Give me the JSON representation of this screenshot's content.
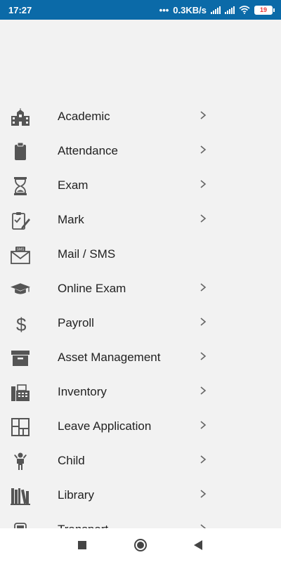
{
  "status_bar": {
    "time": "17:27",
    "network_speed": "0.3KB/s",
    "battery": "19"
  },
  "menu": {
    "items": [
      {
        "label": "Academic",
        "icon": "school-building-icon"
      },
      {
        "label": "Attendance",
        "icon": "clipboard-icon"
      },
      {
        "label": "Exam",
        "icon": "hourglass-icon"
      },
      {
        "label": "Mark",
        "icon": "clipboard-check-pencil-icon"
      },
      {
        "label": "Mail / SMS",
        "icon": "mail-sms-icon"
      },
      {
        "label": "Online Exam",
        "icon": "graduation-cap-icon"
      },
      {
        "label": "Payroll",
        "icon": "dollar-icon"
      },
      {
        "label": "Asset Management",
        "icon": "archive-box-icon"
      },
      {
        "label": "Inventory",
        "icon": "fax-machine-icon"
      },
      {
        "label": "Leave Application",
        "icon": "layout-grid-icon"
      },
      {
        "label": "Child",
        "icon": "child-icon"
      },
      {
        "label": "Library",
        "icon": "books-icon"
      },
      {
        "label": "Transport",
        "icon": "bus-icon"
      }
    ]
  },
  "nav": {
    "buttons": [
      "recent-apps",
      "home",
      "back"
    ]
  },
  "colors": {
    "status_bar": "#0b6aa8",
    "background": "#f2f2f2",
    "icon": "#555555"
  }
}
